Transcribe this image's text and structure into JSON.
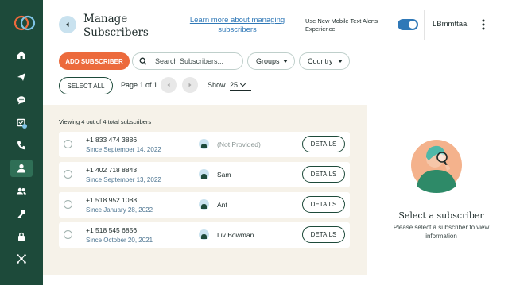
{
  "sidebar": {
    "items": [
      {
        "name": "home",
        "icon": "home-icon"
      },
      {
        "name": "send",
        "icon": "send-icon"
      },
      {
        "name": "messages",
        "icon": "chat-bubble-icon"
      },
      {
        "name": "inbox",
        "icon": "inbox-icon",
        "badge": "2"
      },
      {
        "name": "calls",
        "icon": "phone-icon"
      },
      {
        "name": "subscribers",
        "icon": "user-icon",
        "active": true
      },
      {
        "name": "groups",
        "icon": "users-icon"
      },
      {
        "name": "keywords",
        "icon": "key-icon"
      },
      {
        "name": "security",
        "icon": "lock-icon"
      },
      {
        "name": "integrations",
        "icon": "network-icon"
      }
    ]
  },
  "header": {
    "title": "Manage Subscribers",
    "learn_link": "Learn more about managing subscribers",
    "new_experience_label": "Use New Mobile Text Alerts Experience",
    "new_experience_enabled": true,
    "user_name": "LBmmttaa"
  },
  "toolbar": {
    "add_label": "ADD SUBSCRIBER",
    "search_placeholder": "Search Subscribers...",
    "groups_label": "Groups",
    "country_label": "Country",
    "select_all_label": "SELECT ALL",
    "page_info": "Page 1 of 1",
    "show_label": "Show",
    "show_value": "25"
  },
  "list": {
    "viewing_text": "Viewing 4 out of 4 total subscribers",
    "details_label": "DETAILS",
    "rows": [
      {
        "phone": "+1 833 474 3886",
        "since": "Since September 14, 2022",
        "name": "(Not Provided)"
      },
      {
        "phone": "+1 402 718 8843",
        "since": "Since September 13, 2022",
        "name": "Sam"
      },
      {
        "phone": "+1 518 952 1088",
        "since": "Since January 28, 2022",
        "name": "Ant"
      },
      {
        "phone": "+1 518 545 6856",
        "since": "Since October 20, 2021",
        "name": "Liv Bowman"
      }
    ]
  },
  "detail_panel": {
    "title": "Select a subscriber",
    "subtitle": "Please select a subscriber to view information"
  },
  "colors": {
    "sidebar": "#1d4a3a",
    "accent_orange": "#ec6a3c",
    "link_blue": "#2f78b7",
    "list_background": "#f6f2e9"
  }
}
